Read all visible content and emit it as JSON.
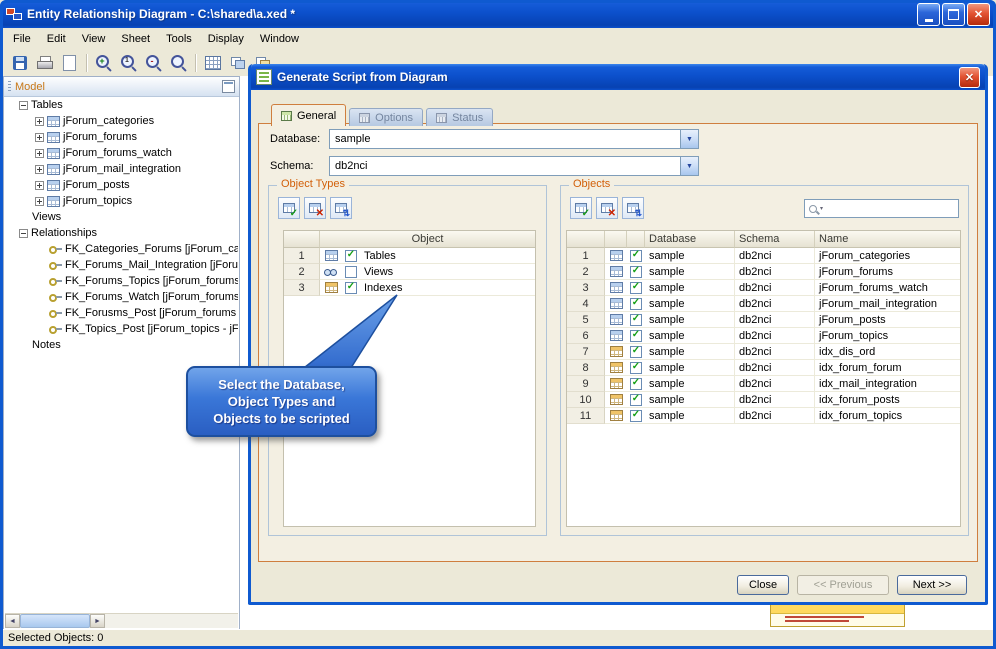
{
  "window": {
    "title": "Entity Relationship Diagram - C:\\shared\\a.xed *",
    "menu": [
      {
        "name": "menu-file",
        "label": "File"
      },
      {
        "name": "menu-edit",
        "label": "Edit"
      },
      {
        "name": "menu-view",
        "label": "View"
      },
      {
        "name": "menu-sheet",
        "label": "Sheet"
      },
      {
        "name": "menu-tools",
        "label": "Tools"
      },
      {
        "name": "menu-display",
        "label": "Display"
      },
      {
        "name": "menu-window",
        "label": "Window"
      }
    ],
    "toolbar_group1": [
      {
        "name": "save-button",
        "icon": "save"
      },
      {
        "name": "print-button",
        "icon": "print"
      },
      {
        "name": "page-button",
        "icon": "page"
      }
    ],
    "toolbar_group2": [
      {
        "name": "zoom-in-button",
        "icon": "zoom-in"
      },
      {
        "name": "zoom-100-button",
        "icon": "zoom-100"
      },
      {
        "name": "zoom-out-button",
        "icon": "zoom-out"
      },
      {
        "name": "zoom-fit-button",
        "icon": "zoom-fit"
      }
    ],
    "toolbar_group3": [
      {
        "name": "grid-button",
        "icon": "grid"
      },
      {
        "name": "arrange-button",
        "icon": "layers"
      },
      {
        "name": "overview-button",
        "icon": "layers2"
      }
    ],
    "status_bar": "Selected Objects: 0"
  },
  "model_panel": {
    "title": "Model",
    "tree": {
      "tables_label": "Tables",
      "tables": [
        {
          "label": "jForum_categories"
        },
        {
          "label": "jForum_forums"
        },
        {
          "label": "jForum_forums_watch"
        },
        {
          "label": "jForum_mail_integration"
        },
        {
          "label": "jForum_posts"
        },
        {
          "label": "jForum_topics"
        }
      ],
      "views_label": "Views",
      "relationships_label": "Relationships",
      "relationships": [
        {
          "label": "FK_Categories_Forums [jForum_ca"
        },
        {
          "label": "FK_Forums_Mail_Integration [jForu"
        },
        {
          "label": "FK_Forums_Topics [jForum_forums"
        },
        {
          "label": "FK_Forums_Watch [jForum_forums"
        },
        {
          "label": "FK_Forusms_Post [jForum_forums"
        },
        {
          "label": "FK_Topics_Post [jForum_topics - jF"
        }
      ],
      "notes_label": "Notes"
    }
  },
  "dialog": {
    "title": "Generate Script from Diagram",
    "tabs": {
      "general": "General",
      "options": "Options",
      "status": "Status"
    },
    "fields": {
      "database_label": "Database:",
      "database_value": "sample",
      "schema_label": "Schema:",
      "schema_value": "db2nci"
    },
    "object_types": {
      "title": "Object Types",
      "header": "Object",
      "rows": [
        {
          "num": "1",
          "icon": "table",
          "checked": true,
          "label": "Tables"
        },
        {
          "num": "2",
          "icon": "view",
          "checked": false,
          "label": "Views"
        },
        {
          "num": "3",
          "icon": "index",
          "checked": true,
          "label": "Indexes"
        }
      ]
    },
    "objects": {
      "title": "Objects",
      "columns": {
        "database": "Database",
        "schema": "Schema",
        "name": "Name"
      },
      "search_value": "",
      "rows": [
        {
          "num": "1",
          "icon": "table",
          "checked": true,
          "database": "sample",
          "schema": "db2nci",
          "name": "jForum_categories"
        },
        {
          "num": "2",
          "icon": "table",
          "checked": true,
          "database": "sample",
          "schema": "db2nci",
          "name": "jForum_forums"
        },
        {
          "num": "3",
          "icon": "table",
          "checked": true,
          "database": "sample",
          "schema": "db2nci",
          "name": "jForum_forums_watch"
        },
        {
          "num": "4",
          "icon": "table",
          "checked": true,
          "database": "sample",
          "schema": "db2nci",
          "name": "jForum_mail_integration"
        },
        {
          "num": "5",
          "icon": "table",
          "checked": true,
          "database": "sample",
          "schema": "db2nci",
          "name": "jForum_posts"
        },
        {
          "num": "6",
          "icon": "table",
          "checked": true,
          "database": "sample",
          "schema": "db2nci",
          "name": "jForum_topics"
        },
        {
          "num": "7",
          "icon": "index",
          "checked": true,
          "database": "sample",
          "schema": "db2nci",
          "name": "idx_dis_ord"
        },
        {
          "num": "8",
          "icon": "index",
          "checked": true,
          "database": "sample",
          "schema": "db2nci",
          "name": "idx_forum_forum"
        },
        {
          "num": "9",
          "icon": "index",
          "checked": true,
          "database": "sample",
          "schema": "db2nci",
          "name": "idx_mail_integration"
        },
        {
          "num": "10",
          "icon": "index",
          "checked": true,
          "database": "sample",
          "schema": "db2nci",
          "name": "idx_forum_posts"
        },
        {
          "num": "11",
          "icon": "index",
          "checked": true,
          "database": "sample",
          "schema": "db2nci",
          "name": "idx_forum_topics"
        }
      ]
    },
    "buttons": {
      "close": "Close",
      "previous": "<< Previous",
      "next": "Next >>"
    }
  },
  "callout": {
    "line1": "Select the Database,",
    "line2": "Object Types and",
    "line3": "Objects to be scripted"
  }
}
